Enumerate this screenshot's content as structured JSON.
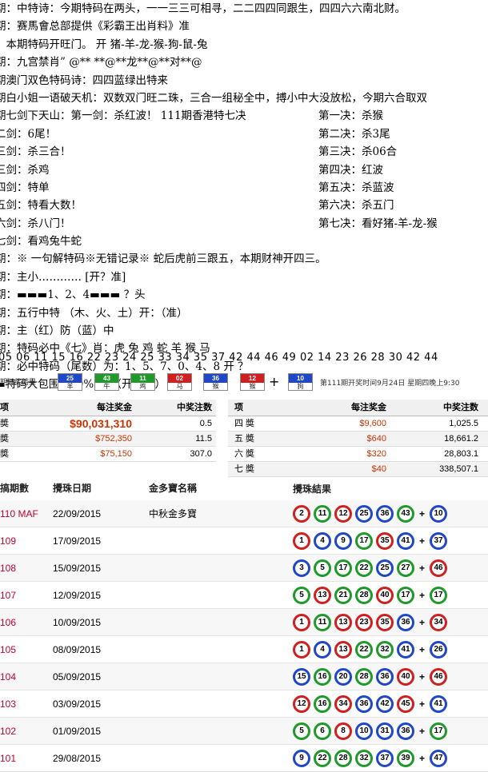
{
  "lines": [
    {
      "text": "期：中特诗：今期特码在两头，一一三三可相寻，二二四四同跟生，四四六六南北财。"
    },
    {
      "text": "期：赛馬會总部提供《彩霸王出肖料》准"
    },
    {
      "text": "：本期特码开旺门。      开 猪-羊-龙-猴-狗-鼠-兔"
    },
    {
      "text": "期：九宫禁肖” @** **@**龙**@**对**@"
    },
    {
      "text": "期澳门双色特码诗：四四蓝绿出特来"
    },
    {
      "text": "期白小姐一语破天机：双数双门旺二珠，三合一组秘全中，搏小中大没放松，今期六合取双"
    }
  ],
  "sword_lines": [
    {
      "left": "期七剑下天山：第一剑：杀红波！     111期香港特七决",
      "right": "第一决：杀猴"
    },
    {
      "left": "二剑：6尾！",
      "right": "第二决：杀3尾"
    },
    {
      "left": "三剑：杀三合！",
      "right": "第三决：杀06合"
    },
    {
      "left": "三剑：杀鸡",
      "right": "第四决：红波"
    },
    {
      "left": "四剑：特单",
      "right": "第五决：杀蓝波"
    },
    {
      "left": "五剑：特看大数！",
      "right": "第六决：杀五门"
    },
    {
      "left": "六剑：杀八门！",
      "right": "第七决：看好猪-羊-龙-猴"
    }
  ],
  "lines2": [
    {
      "text": "七剑：看鸡兔牛蛇"
    },
    {
      "text": "期：※ 一句解特码※无错记录※ 蛇后虎前三跟五，本期财神开四三。"
    },
    {
      "text": "期：主小………… [开？准]"
    },
    {
      "text": "期：▬▬▬1、2、4▬▬▬ ？头"
    },
    {
      "text": "期：五行中特 （木、火、土）开：（准）"
    },
    {
      "text": "期：主（红）防（蓝）中"
    },
    {
      "text": "期：特码必中《七》肖：虎 兔 鸡 蛇 羊 猴 马"
    },
    {
      "text": "期：必中特码（尾数）为：1、5、7、0、4、8    开 ？"
    },
    {
      "text": "▬特码大包围 100% ▬    （开??准）"
    }
  ],
  "numbers_row": "05 06 11 15 16 22 23 24 25 33 34 35 37 42 44 46 49 02 14 23 26 28 30 42 44",
  "draw": {
    "label": "期开奖结果",
    "balls": [
      {
        "num": "25",
        "zodiac": "羊",
        "color": "#1f47c8"
      },
      {
        "num": "43",
        "zodiac": "牛",
        "color": "#1f9a2a"
      },
      {
        "num": "11",
        "zodiac": "鸡",
        "color": "#1f9a2a"
      },
      {
        "num": "02",
        "zodiac": "马",
        "color": "#d01f1f"
      },
      {
        "num": "36",
        "zodiac": "猴",
        "color": "#1f47c8"
      },
      {
        "num": "12",
        "zodiac": "猴",
        "color": "#d01f1f"
      }
    ],
    "plus": "+",
    "special": {
      "num": "10",
      "zodiac": "狗",
      "color": "#1f47c8"
    },
    "next_info": "第111期开奖时间9月24日 星期四晚上9:30"
  },
  "prize_left": {
    "headers": [
      "项",
      "每注奖金",
      "中奖注数"
    ],
    "rows": [
      {
        "name": "奬",
        "amount": "$90,031,310",
        "count": "0.5",
        "big": true
      },
      {
        "name": "奬",
        "amount": "$752,350",
        "count": "11.5"
      },
      {
        "name": "奬",
        "amount": "$75,150",
        "count": "307.0"
      }
    ]
  },
  "prize_right": {
    "headers": [
      "项",
      "每注奖金",
      "中奖注数"
    ],
    "rows": [
      {
        "name": "四 奬",
        "amount": "$9,600",
        "count": "1,025.5"
      },
      {
        "name": "五 奬",
        "amount": "$640",
        "count": "18,661.2"
      },
      {
        "name": "六 奬",
        "amount": "$320",
        "count": "28,803.1"
      },
      {
        "name": "七 奬",
        "amount": "$40",
        "count": "338,507.1"
      }
    ]
  },
  "history": {
    "headers": [
      "搞期數",
      "攪珠日期",
      "金多寶名稱",
      "攪珠結果"
    ],
    "rows": [
      {
        "draw": "110 MAF",
        "date": "22/09/2015",
        "jackpot": "中秋金多寶",
        "balls": [
          "2",
          "11",
          "12",
          "25",
          "36",
          "43"
        ],
        "special": "10"
      },
      {
        "draw": "109",
        "date": "17/09/2015",
        "jackpot": "",
        "balls": [
          "1",
          "4",
          "9",
          "17",
          "35",
          "41"
        ],
        "special": "37"
      },
      {
        "draw": "108",
        "date": "15/09/2015",
        "jackpot": "",
        "balls": [
          "3",
          "5",
          "17",
          "22",
          "25",
          "27"
        ],
        "special": "46"
      },
      {
        "draw": "107",
        "date": "12/09/2015",
        "jackpot": "",
        "balls": [
          "5",
          "13",
          "21",
          "28",
          "40",
          "17"
        ],
        "special": "17"
      },
      {
        "draw": "106",
        "date": "10/09/2015",
        "jackpot": "",
        "balls": [
          "1",
          "11",
          "13",
          "23",
          "35",
          "36"
        ],
        "special": "34"
      },
      {
        "draw": "105",
        "date": "08/09/2015",
        "jackpot": "",
        "balls": [
          "1",
          "4",
          "13",
          "22",
          "32",
          "41"
        ],
        "special": "26"
      },
      {
        "draw": "104",
        "date": "05/09/2015",
        "jackpot": "",
        "balls": [
          "15",
          "16",
          "20",
          "28",
          "36",
          "40"
        ],
        "special": "46"
      },
      {
        "draw": "103",
        "date": "03/09/2015",
        "jackpot": "",
        "balls": [
          "12",
          "16",
          "34",
          "36",
          "42",
          "45"
        ],
        "special": "41"
      },
      {
        "draw": "102",
        "date": "01/09/2015",
        "jackpot": "",
        "balls": [
          "5",
          "6",
          "8",
          "10",
          "31",
          "36"
        ],
        "special": "17"
      },
      {
        "draw": "101",
        "date": "29/08/2015",
        "jackpot": "",
        "balls": [
          "9",
          "22",
          "28",
          "32",
          "37",
          "39"
        ],
        "special": "47"
      }
    ]
  },
  "colors": {
    "red_ball": "#d01f1f",
    "blue_ball": "#1f47c8",
    "green_ball": "#1f9a2a"
  }
}
